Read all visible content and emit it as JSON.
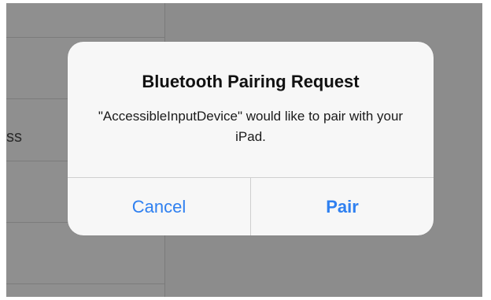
{
  "background": {
    "list_row_partial_text": "ss"
  },
  "alert": {
    "title": "Bluetooth Pairing Request",
    "message": "\"AccessibleInputDevice\" would like to pair with your iPad.",
    "cancel_label": "Cancel",
    "pair_label": "Pair"
  },
  "colors": {
    "accent": "#2f80f0",
    "alert_background": "#f7f7f7",
    "dimmed_backdrop": "#8a8a8a"
  }
}
